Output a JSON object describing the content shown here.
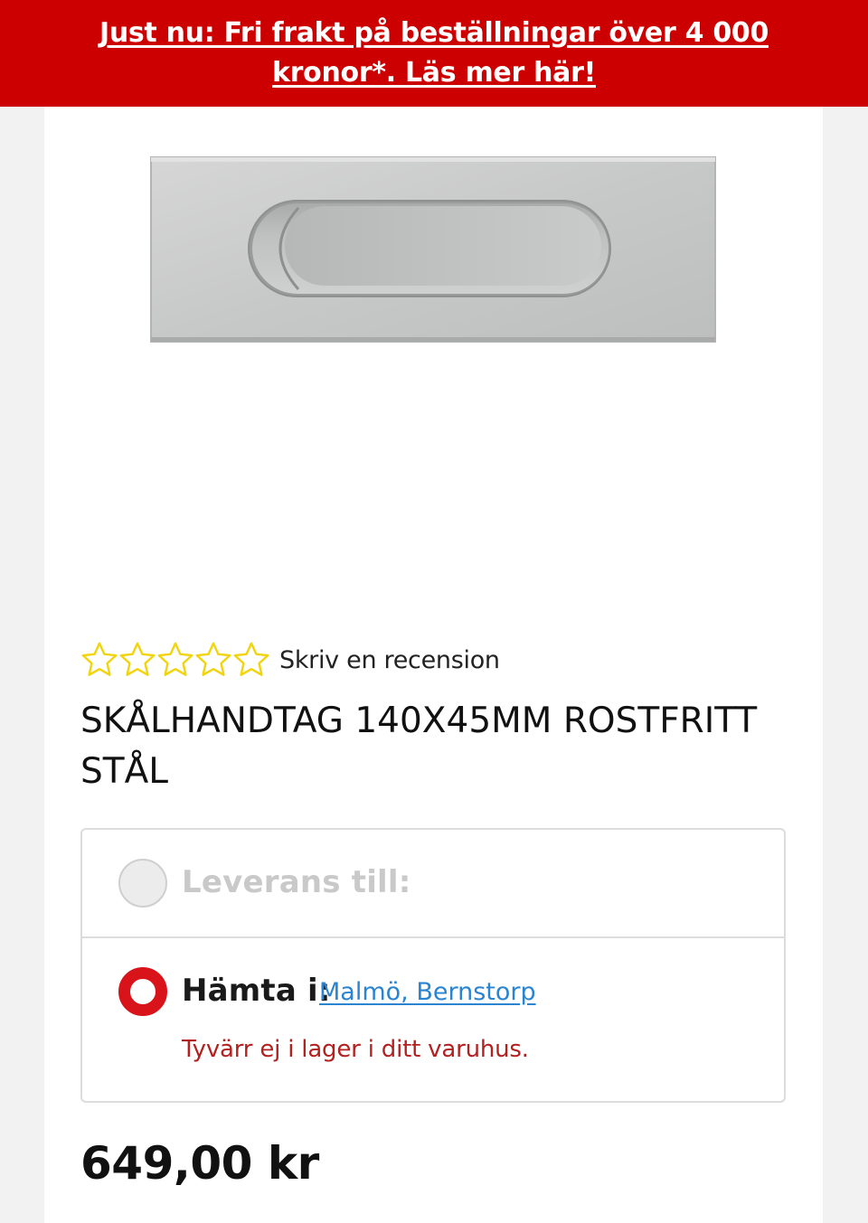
{
  "banner": {
    "text": "Just nu: Fri frakt på beställningar över 4 000 kronor*. Läs mer här!",
    "color": "#cc0000"
  },
  "product": {
    "image_icon": "stainless-steel-recessed-handle",
    "rating": 0,
    "rating_max": 5,
    "review_link": "Skriv en recension",
    "title": "SKÅLHANDTAG 140X45MM ROSTFRITT STÅL",
    "price": "649,00 kr"
  },
  "delivery": {
    "ship_label": "Leverans till:",
    "ship_selected": false,
    "pickup_label": "Hämta i:",
    "pickup_selected": true,
    "store": "Malmö, Bernstorp",
    "stock_message": "Tyvärr ej i lager i ditt varuhus.",
    "accent_color": "#d8141a",
    "link_color": "#2b84d0"
  },
  "icons": {
    "star": "star-outline-icon"
  }
}
